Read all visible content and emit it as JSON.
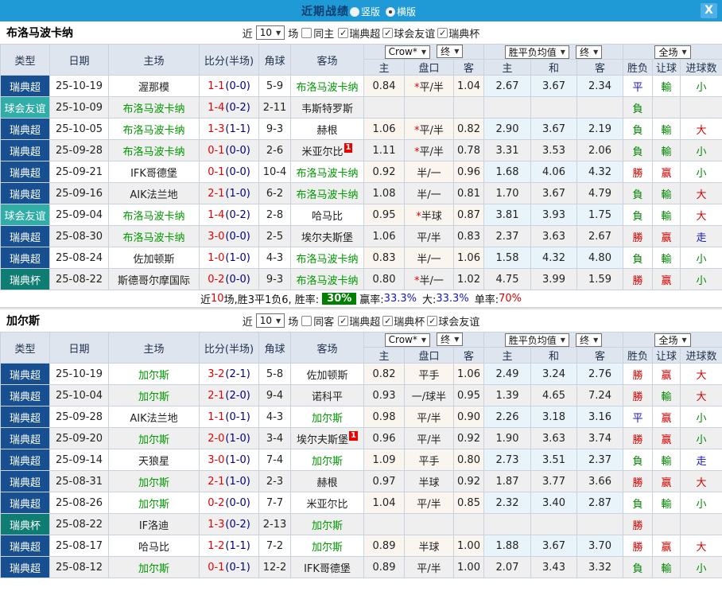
{
  "titlebar": {
    "title": "近期战绩",
    "vertical_label": "竖版",
    "horizontal_label": "横版",
    "close_label": "X"
  },
  "colors": {
    "topbar": "#1f9ad7",
    "title_text": "#0b3e6e",
    "league": {
      "瑞典超": "#174f91",
      "球会友谊": "#2fada6",
      "瑞典杯": "#0f7d72"
    },
    "marks": {
      "勝": "#d60000",
      "赢": "#d60000",
      "大": "#d60000",
      "負": "#008800",
      "輸": "#008800",
      "小": "#008800",
      "平": "#1414d6",
      "走": "#1414d6"
    },
    "team_green": "#009900",
    "score_red": "#e60000",
    "half_navy": "#000080",
    "badge_green": "#008000"
  },
  "table_head": {
    "type": "类型",
    "date": "日期",
    "home": "主场",
    "score": "比分(半场)",
    "corner": "角球",
    "away": "客场",
    "crow_select": "Crow*",
    "end_select": "终",
    "mean_select": "胜平负均值",
    "end_select2": "终",
    "scope_select": "全场",
    "sub": {
      "home": "主",
      "handicap": "盘口",
      "away": "客",
      "mean_home": "主",
      "mean_draw": "和",
      "mean_away": "客",
      "result": "胜负",
      "handicap_result": "让球",
      "goals": "进球数"
    }
  },
  "filter_common": {
    "near": "近",
    "count": "10",
    "games": "场"
  },
  "sections": [
    {
      "team": "布洛马波卡纳",
      "same_label": "同主",
      "leagues": [
        "瑞典超",
        "球会友谊",
        "瑞典杯"
      ],
      "rows": [
        {
          "type": "瑞典超",
          "date": "25-10-19",
          "home": "渥那模",
          "home_green": false,
          "score": "1-1",
          "half": "(0-0)",
          "corner": "5-9",
          "away": "布洛马波卡纳",
          "away_green": true,
          "odds": [
            "0.84",
            "平/半",
            "1.04"
          ],
          "star": true,
          "means": [
            "2.67",
            "3.67",
            "2.34"
          ],
          "result": "平",
          "handicap_result": "輸",
          "goals": "小"
        },
        {
          "type": "球会友谊",
          "date": "25-10-09",
          "home": "布洛马波卡纳",
          "home_green": true,
          "score": "1-4",
          "half": "(0-2)",
          "corner": "2-11",
          "away": "韦斯特罗斯",
          "away_green": false,
          "odds": [
            "",
            "",
            ""
          ],
          "star": false,
          "means": [
            "",
            "",
            ""
          ],
          "result": "負",
          "handicap_result": "",
          "goals": ""
        },
        {
          "type": "瑞典超",
          "date": "25-10-05",
          "home": "布洛马波卡纳",
          "home_green": true,
          "score": "1-3",
          "half": "(1-1)",
          "corner": "9-3",
          "away": "赫根",
          "away_green": false,
          "odds": [
            "1.06",
            "平/半",
            "0.82"
          ],
          "star": true,
          "means": [
            "2.90",
            "3.67",
            "2.19"
          ],
          "result": "負",
          "handicap_result": "輸",
          "goals": "大"
        },
        {
          "type": "瑞典超",
          "date": "25-09-28",
          "home": "布洛马波卡纳",
          "home_green": true,
          "score": "0-1",
          "half": "(0-0)",
          "corner": "2-6",
          "away": "米亚尔比",
          "away_green": false,
          "away_card": "1",
          "odds": [
            "1.11",
            "平/半",
            "0.78"
          ],
          "star": true,
          "means": [
            "3.31",
            "3.53",
            "2.06"
          ],
          "result": "負",
          "handicap_result": "輸",
          "goals": "小"
        },
        {
          "type": "瑞典超",
          "date": "25-09-21",
          "home": "IFK哥德堡",
          "home_green": false,
          "score": "0-1",
          "half": "(0-0)",
          "corner": "10-4",
          "away": "布洛马波卡纳",
          "away_green": true,
          "odds": [
            "0.92",
            "半/一",
            "0.96"
          ],
          "star": false,
          "means": [
            "1.68",
            "4.06",
            "4.32"
          ],
          "result": "勝",
          "handicap_result": "赢",
          "goals": "小"
        },
        {
          "type": "瑞典超",
          "date": "25-09-16",
          "home": "AIK法兰地",
          "home_green": false,
          "score": "2-1",
          "half": "(1-0)",
          "corner": "6-2",
          "away": "布洛马波卡纳",
          "away_green": true,
          "odds": [
            "1.08",
            "半/一",
            "0.81"
          ],
          "star": false,
          "means": [
            "1.70",
            "3.67",
            "4.79"
          ],
          "result": "負",
          "handicap_result": "輸",
          "goals": "大"
        },
        {
          "type": "球会友谊",
          "date": "25-09-04",
          "home": "布洛马波卡纳",
          "home_green": true,
          "score": "1-4",
          "half": "(0-2)",
          "corner": "2-8",
          "away": "哈马比",
          "away_green": false,
          "odds": [
            "0.95",
            "半球",
            "0.87"
          ],
          "star": true,
          "means": [
            "3.81",
            "3.93",
            "1.75"
          ],
          "result": "負",
          "handicap_result": "輸",
          "goals": "大"
        },
        {
          "type": "瑞典超",
          "date": "25-08-30",
          "home": "布洛马波卡纳",
          "home_green": true,
          "score": "3-0",
          "half": "(0-0)",
          "corner": "2-5",
          "away": "埃尔夫斯堡",
          "away_green": false,
          "odds": [
            "1.06",
            "平/半",
            "0.83"
          ],
          "star": false,
          "means": [
            "2.37",
            "3.63",
            "2.67"
          ],
          "result": "勝",
          "handicap_result": "赢",
          "goals": "走"
        },
        {
          "type": "瑞典超",
          "date": "25-08-24",
          "home": "佐加顿斯",
          "home_green": false,
          "score": "1-0",
          "half": "(1-0)",
          "corner": "4-3",
          "away": "布洛马波卡纳",
          "away_green": true,
          "odds": [
            "0.83",
            "半/一",
            "1.06"
          ],
          "star": false,
          "means": [
            "1.58",
            "4.32",
            "4.80"
          ],
          "result": "負",
          "handicap_result": "輸",
          "goals": "小"
        },
        {
          "type": "瑞典杯",
          "date": "25-08-22",
          "home": "斯德哥尔摩国际",
          "home_green": false,
          "score": "0-2",
          "half": "(0-0)",
          "corner": "9-3",
          "away": "布洛马波卡纳",
          "away_green": true,
          "odds": [
            "0.80",
            "半/一",
            "1.02"
          ],
          "star": true,
          "means": [
            "4.75",
            "3.99",
            "1.59"
          ],
          "result": "勝",
          "handicap_result": "赢",
          "goals": "小"
        }
      ],
      "summary": {
        "seg1": "近",
        "seg2": "10",
        "seg3": "场,胜3平1负6, 胜率:",
        "badge": "30%",
        "seg4": "赢率:",
        "val1": "33.3%",
        "seg5": "大:",
        "val2": "33.3%",
        "seg6": "单率:",
        "val3": "70%"
      }
    },
    {
      "team": "加尔斯",
      "same_label": "同客",
      "leagues": [
        "瑞典超",
        "瑞典杯",
        "球会友谊"
      ],
      "rows": [
        {
          "type": "瑞典超",
          "date": "25-10-19",
          "home": "加尔斯",
          "home_green": true,
          "score": "3-2",
          "half": "(2-1)",
          "corner": "5-8",
          "away": "佐加顿斯",
          "away_green": false,
          "odds": [
            "0.82",
            "平手",
            "1.06"
          ],
          "star": false,
          "means": [
            "2.49",
            "3.24",
            "2.76"
          ],
          "result": "勝",
          "handicap_result": "赢",
          "goals": "大"
        },
        {
          "type": "瑞典超",
          "date": "25-10-04",
          "home": "加尔斯",
          "home_green": true,
          "score": "2-1",
          "half": "(2-0)",
          "corner": "9-4",
          "away": "诺科平",
          "away_green": false,
          "odds": [
            "0.93",
            "一/球半",
            "0.95"
          ],
          "star": false,
          "means": [
            "1.39",
            "4.65",
            "7.24"
          ],
          "result": "勝",
          "handicap_result": "輸",
          "goals": "大"
        },
        {
          "type": "瑞典超",
          "date": "25-09-28",
          "home": "AIK法兰地",
          "home_green": false,
          "score": "1-1",
          "half": "(0-1)",
          "corner": "4-3",
          "away": "加尔斯",
          "away_green": true,
          "odds": [
            "0.98",
            "平/半",
            "0.90"
          ],
          "star": false,
          "means": [
            "2.26",
            "3.18",
            "3.16"
          ],
          "result": "平",
          "handicap_result": "赢",
          "goals": "小"
        },
        {
          "type": "瑞典超",
          "date": "25-09-20",
          "home": "加尔斯",
          "home_green": true,
          "score": "2-0",
          "half": "(1-0)",
          "corner": "3-4",
          "away": "埃尔夫斯堡",
          "away_green": false,
          "away_card": "1",
          "odds": [
            "0.96",
            "平/半",
            "0.92"
          ],
          "star": false,
          "means": [
            "1.90",
            "3.63",
            "3.74"
          ],
          "result": "勝",
          "handicap_result": "赢",
          "goals": "小"
        },
        {
          "type": "瑞典超",
          "date": "25-09-14",
          "home": "天狼星",
          "home_green": false,
          "score": "3-0",
          "half": "(1-0)",
          "corner": "7-4",
          "away": "加尔斯",
          "away_green": true,
          "odds": [
            "1.09",
            "平手",
            "0.80"
          ],
          "star": false,
          "means": [
            "2.73",
            "3.51",
            "2.37"
          ],
          "result": "負",
          "handicap_result": "輸",
          "goals": "走"
        },
        {
          "type": "瑞典超",
          "date": "25-08-31",
          "home": "加尔斯",
          "home_green": true,
          "score": "2-1",
          "half": "(1-0)",
          "corner": "2-3",
          "away": "赫根",
          "away_green": false,
          "odds": [
            "0.97",
            "半球",
            "0.92"
          ],
          "star": false,
          "means": [
            "1.87",
            "3.77",
            "3.66"
          ],
          "result": "勝",
          "handicap_result": "赢",
          "goals": "大"
        },
        {
          "type": "瑞典超",
          "date": "25-08-26",
          "home": "加尔斯",
          "home_green": true,
          "score": "0-2",
          "half": "(0-0)",
          "corner": "7-7",
          "away": "米亚尔比",
          "away_green": false,
          "odds": [
            "1.04",
            "平/半",
            "0.85"
          ],
          "star": false,
          "means": [
            "2.32",
            "3.40",
            "2.87"
          ],
          "result": "負",
          "handicap_result": "輸",
          "goals": "小"
        },
        {
          "type": "瑞典杯",
          "date": "25-08-22",
          "home": "IF洛迪",
          "home_green": false,
          "score": "1-3",
          "half": "(0-2)",
          "corner": "2-13",
          "away": "加尔斯",
          "away_green": true,
          "odds": [
            "",
            "",
            ""
          ],
          "star": false,
          "means": [
            "",
            "",
            ""
          ],
          "result": "勝",
          "handicap_result": "",
          "goals": ""
        },
        {
          "type": "瑞典超",
          "date": "25-08-17",
          "home": "哈马比",
          "home_green": false,
          "score": "1-2",
          "half": "(1-1)",
          "corner": "7-2",
          "away": "加尔斯",
          "away_green": true,
          "odds": [
            "0.89",
            "半球",
            "1.00"
          ],
          "star": false,
          "means": [
            "1.88",
            "3.67",
            "3.70"
          ],
          "result": "勝",
          "handicap_result": "赢",
          "goals": "大"
        },
        {
          "type": "瑞典超",
          "date": "25-08-12",
          "home": "加尔斯",
          "home_green": true,
          "score": "0-1",
          "half": "(0-1)",
          "corner": "12-2",
          "away": "IFK哥德堡",
          "away_green": false,
          "odds": [
            "0.89",
            "平/半",
            "1.00"
          ],
          "star": false,
          "means": [
            "2.07",
            "3.43",
            "3.32"
          ],
          "result": "負",
          "handicap_result": "輸",
          "goals": "小"
        }
      ]
    }
  ]
}
